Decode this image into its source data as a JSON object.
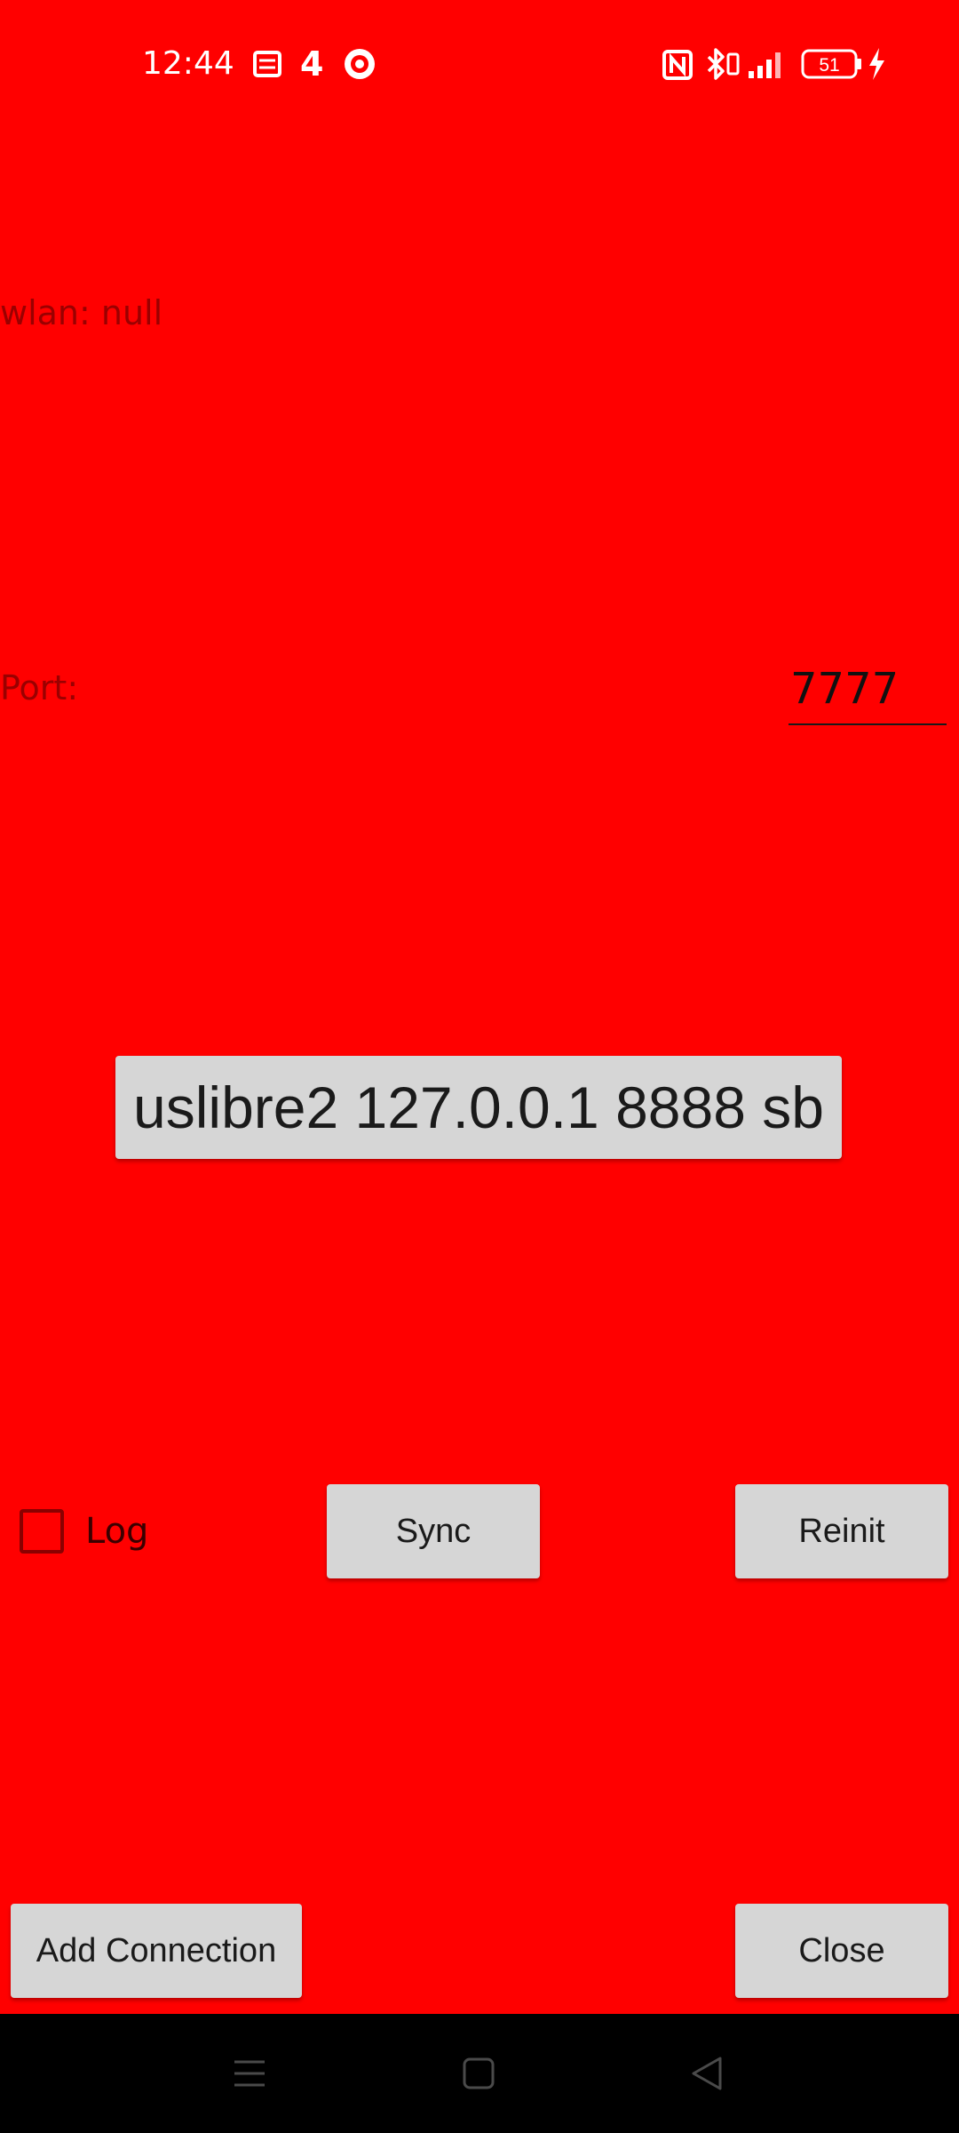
{
  "status_bar": {
    "time": "12:44",
    "network_badge": "4",
    "battery_level": "51",
    "icons": [
      "sim-card-icon",
      "target-icon",
      "nfc-icon",
      "bluetooth-icon",
      "signal-icon",
      "battery-icon",
      "charging-icon"
    ]
  },
  "wlan": {
    "text": "wlan: null"
  },
  "port": {
    "label": "Port:",
    "value": "7777"
  },
  "connection": {
    "label": "uslibre2 127.0.0.1 8888 sb"
  },
  "controls": {
    "log_label": "Log",
    "log_checked": false,
    "sync_label": "Sync",
    "reinit_label": "Reinit"
  },
  "footer": {
    "add_connection_label": "Add Connection",
    "close_label": "Close"
  },
  "colors": {
    "background": "#ff0000",
    "button": "#d6d6d6",
    "navbar": "#000000"
  }
}
